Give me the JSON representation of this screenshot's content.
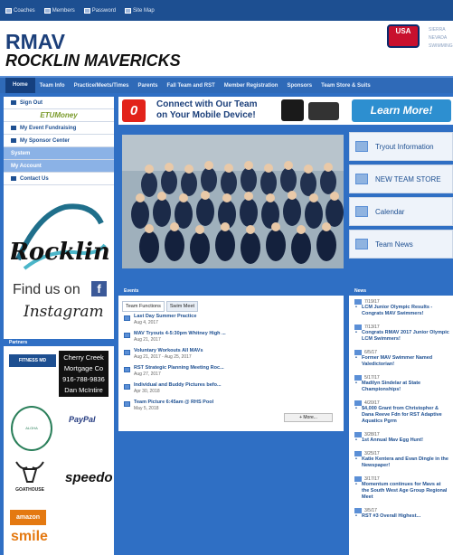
{
  "topbar": {
    "items": [
      "Coaches",
      "Members",
      "Password",
      "Site Map"
    ]
  },
  "header": {
    "title": "RMAV",
    "subtitle": "ROCKLIN MAVERICKS",
    "usa_logo": "USA",
    "region": [
      "SIERRA",
      "NEVADA",
      "SWIMMING"
    ]
  },
  "nav": {
    "items": [
      "Home",
      "Team Info",
      "Practice/Meets/Times",
      "Parents",
      "Fall Team and RST",
      "Member Registration",
      "Sponsors",
      "Team Store & Suits"
    ]
  },
  "sidebar": {
    "sign_out": "Sign Out",
    "etu": "ETUMoney",
    "items": [
      "My Event Fundraising",
      "My Sponsor Center"
    ],
    "system": "System",
    "my_account": "My Account",
    "contact": "Contact Us"
  },
  "social": {
    "rocklin_logo": "Rocklin",
    "find_us": "Find us on",
    "fb": "f",
    "instagram": "Instagram"
  },
  "partners": {
    "header": "Partners",
    "fitness": "FITNESS MD",
    "cherry": [
      "Cherry Creek",
      "Mortgage Co",
      "916-788-9836",
      "Dan McIntire"
    ],
    "aloha": "ALOHA",
    "paypal": "PayPal",
    "goathouse": "GOATHOUSE",
    "speedo": "speedo",
    "amazon": "amazon",
    "smile": "smile"
  },
  "banner": {
    "text": [
      "Connect with Our Team",
      "on Your Mobile Device!"
    ],
    "button": "Learn More!"
  },
  "right_links": [
    "Tryout Information",
    "NEW TEAM STORE",
    "Calendar",
    "Team News"
  ],
  "events": {
    "header": "Events",
    "tabs": [
      "Team Functions",
      "Swim Meet"
    ],
    "items": [
      {
        "title": "Last Day Summer Practice",
        "date": "Aug 4, 2017"
      },
      {
        "title": "MAV Tryouts 4-5:30pm Whitney High ...",
        "date": "Aug 21, 2017"
      },
      {
        "title": "Voluntary Workouts All MAVs",
        "date": "Aug 21, 2017 - Aug 25, 2017"
      },
      {
        "title": "RST Strategic Planning Meeting Roc...",
        "date": "Aug 27, 2017"
      },
      {
        "title": "Individual and Buddy Pictures befo...",
        "date": "Apr 30, 2018"
      },
      {
        "title": "Team Picture 6:45am @ RHS Pool",
        "date": "May 5, 2018"
      }
    ],
    "more": "+ More..."
  },
  "news": {
    "header": "News",
    "items": [
      {
        "date": "7/19/17",
        "title": "LCM Junior Olympic Results - Congrats MAV Swimmers!"
      },
      {
        "date": "7/13/17",
        "title": "Congrats RMAV 2017 Junior Olympic LCM Swimmers!"
      },
      {
        "date": "6/5/17",
        "title": "Former MAV Swimmer Named Valedictorian!"
      },
      {
        "date": "5/17/17",
        "title": "Madilyn Sindelar at State Championships!"
      },
      {
        "date": "4/20/17",
        "title": "$4,000 Grant from Christopher & Dana Reeve Fdn for RST Adaptive Aquatics Pgrm"
      },
      {
        "date": "3/28/17",
        "title": "1st Annual Mav Egg Hunt!"
      },
      {
        "date": "3/25/17",
        "title": "Katie Kentera and Evan Dingle in the Newspaper!"
      },
      {
        "date": "3/17/17",
        "title": "Momentum continues for Mavs at the South West Age Group Regional Meet"
      },
      {
        "date": "3/5/17",
        "title": "RST #3 Overall Highest..."
      }
    ]
  }
}
